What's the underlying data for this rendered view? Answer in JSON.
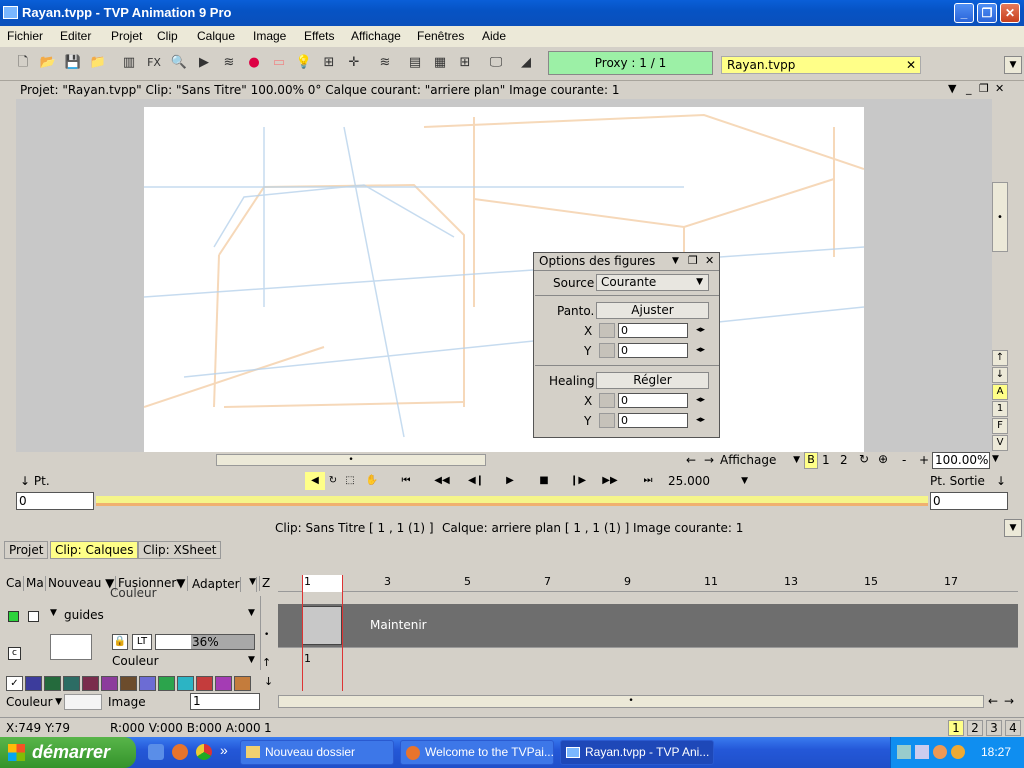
{
  "window": {
    "title": "Rayan.tvpp - TVP Animation 9 Pro",
    "min": "_",
    "max": "❐",
    "close": "✕"
  },
  "menu": [
    "Fichier",
    "Editer",
    "Projet",
    "Clip",
    "Calque",
    "Image",
    "Effets",
    "Affichage",
    "Fenêtres",
    "Aide"
  ],
  "toolbar": {
    "fx_label": "FX",
    "proxy": "Proxy : 1 / 1",
    "file_tab": "Rayan.tvpp",
    "file_close": "✕",
    "dropdown": "▼",
    "icons": [
      "new-file-icon",
      "open-folder-icon",
      "save-icon",
      "folder-icon",
      "brush-settings-icon",
      "fx-icon",
      "zoom-icon",
      "play-icon",
      "layers-icon",
      "color-wheel-icon",
      "swatch-icon",
      "light-icon",
      "grid-icon",
      "crosshair-icon",
      "stack-icon",
      "panel-icon",
      "grid2-icon",
      "grid3-icon",
      "monitor-icon",
      "gradient-icon"
    ]
  },
  "project_bar": {
    "info": "Projet: \"Rayan.tvpp\"  Clip: \"Sans Titre\"   100.00%   0°   Calque courant: \"arriere plan\"  Image courante: 1",
    "ctl_drop": "▼",
    "ctl_min": "_",
    "ctl_restore": "❐",
    "ctl_close": "✕"
  },
  "rail": [
    "↑",
    "↓",
    "A",
    "1",
    "F",
    "V"
  ],
  "rail_scroll": "•",
  "dialog": {
    "title": "Options des figures",
    "source_label": "Source",
    "source_value": "Courante",
    "panto_label": "Panto.",
    "panto_button": "Ajuster",
    "x_label": "X",
    "y_label": "Y",
    "panto_x": "0",
    "panto_y": "0",
    "healing_label": "Healing",
    "healing_button": "Régler",
    "healing_x": "0",
    "healing_y": "0",
    "arrows": "◂▸",
    "drop": "▼",
    "restore": "❐",
    "close": "✕"
  },
  "nav": {
    "arrow_left": "←",
    "arrow_right": "→",
    "display": "Affichage",
    "display_drop": "▼",
    "b": "B",
    "one": "1",
    "two": "2",
    "refresh": "↻",
    "center": "⊕",
    "minus": "-",
    "plus": "+",
    "zoom": "100.00%",
    "zoom_drop": "▼"
  },
  "play": {
    "in_point": "Pt. Entrée",
    "out_point": "Pt. Sortie",
    "in_arrow": "↓",
    "out_arrow": "↓",
    "fps": "25.000",
    "fps_drop": "▼",
    "start_value": "0",
    "end_value": "0"
  },
  "play_icons": [
    {
      "name": "sound-icon",
      "glyph": "◀"
    },
    {
      "name": "loop-icon",
      "glyph": "↻"
    },
    {
      "name": "select-icon",
      "glyph": "⬚"
    },
    {
      "name": "hand-icon",
      "glyph": "✋"
    },
    {
      "name": "first-frame-icon",
      "glyph": "⏮"
    },
    {
      "name": "prev-key-icon",
      "glyph": "◀◀"
    },
    {
      "name": "prev-frame-icon",
      "glyph": "◀❙"
    },
    {
      "name": "play-icon",
      "glyph": "▶"
    },
    {
      "name": "stop-icon",
      "glyph": "■"
    },
    {
      "name": "next-frame-icon",
      "glyph": "❙▶"
    },
    {
      "name": "next-key-icon",
      "glyph": "▶▶"
    },
    {
      "name": "last-frame-icon",
      "glyph": "⏭"
    }
  ],
  "clipbar": {
    "clip": "Clip: Sans Titre [ 1 , 1  (1) ]",
    "layer": "Calque: arriere plan [ 1 , 1  (1) ]",
    "image": "Image courante: 1",
    "drop": "▼"
  },
  "tabs": [
    "Projet",
    "Clip: Calques",
    "Clip: XSheet"
  ],
  "layer_header": {
    "ca": "Ca",
    "ma": "Ma",
    "new": "Nouveau ▼",
    "merge": "Fusionner▼",
    "adapt": "Adapter",
    "adapt_drop": "▼",
    "z": "Z"
  },
  "layer": {
    "name": "guides",
    "prev_label": "Couleur",
    "color_label": "Couleur",
    "opacity": "36%",
    "lock": "🔒",
    "lt": "LT",
    "c_box": "c",
    "collapse": "▼",
    "drop": "▼"
  },
  "ruler": [
    "1",
    "3",
    "5",
    "7",
    "9",
    "11",
    "13",
    "15",
    "17"
  ],
  "track": {
    "hold": "Maintenir",
    "frame": "1"
  },
  "bottom_row": {
    "color": "Couleur",
    "color_drop": "▼",
    "image": "Image",
    "value": "1",
    "left": "←",
    "right": "→"
  },
  "scroll": {
    "up": "↑",
    "down": "↓",
    "thumb": "•"
  },
  "status": {
    "coords": "X:749  Y:79",
    "rgba": "R:000 V:000 B:000 A:000",
    "value": "1",
    "pages": [
      "1",
      "2",
      "3",
      "4"
    ]
  },
  "taskbar": {
    "start": "démarrer",
    "quick": "»",
    "tasks": [
      "Nouveau dossier",
      "Welcome to the TVPai...",
      "Rayan.tvpp - TVP Ani..."
    ],
    "clock": "18:27"
  },
  "colors": {
    "accent_yellow": "#ffff88",
    "proxy_green": "#9cf0a6",
    "timeline_yellow": "#f5f58a"
  }
}
